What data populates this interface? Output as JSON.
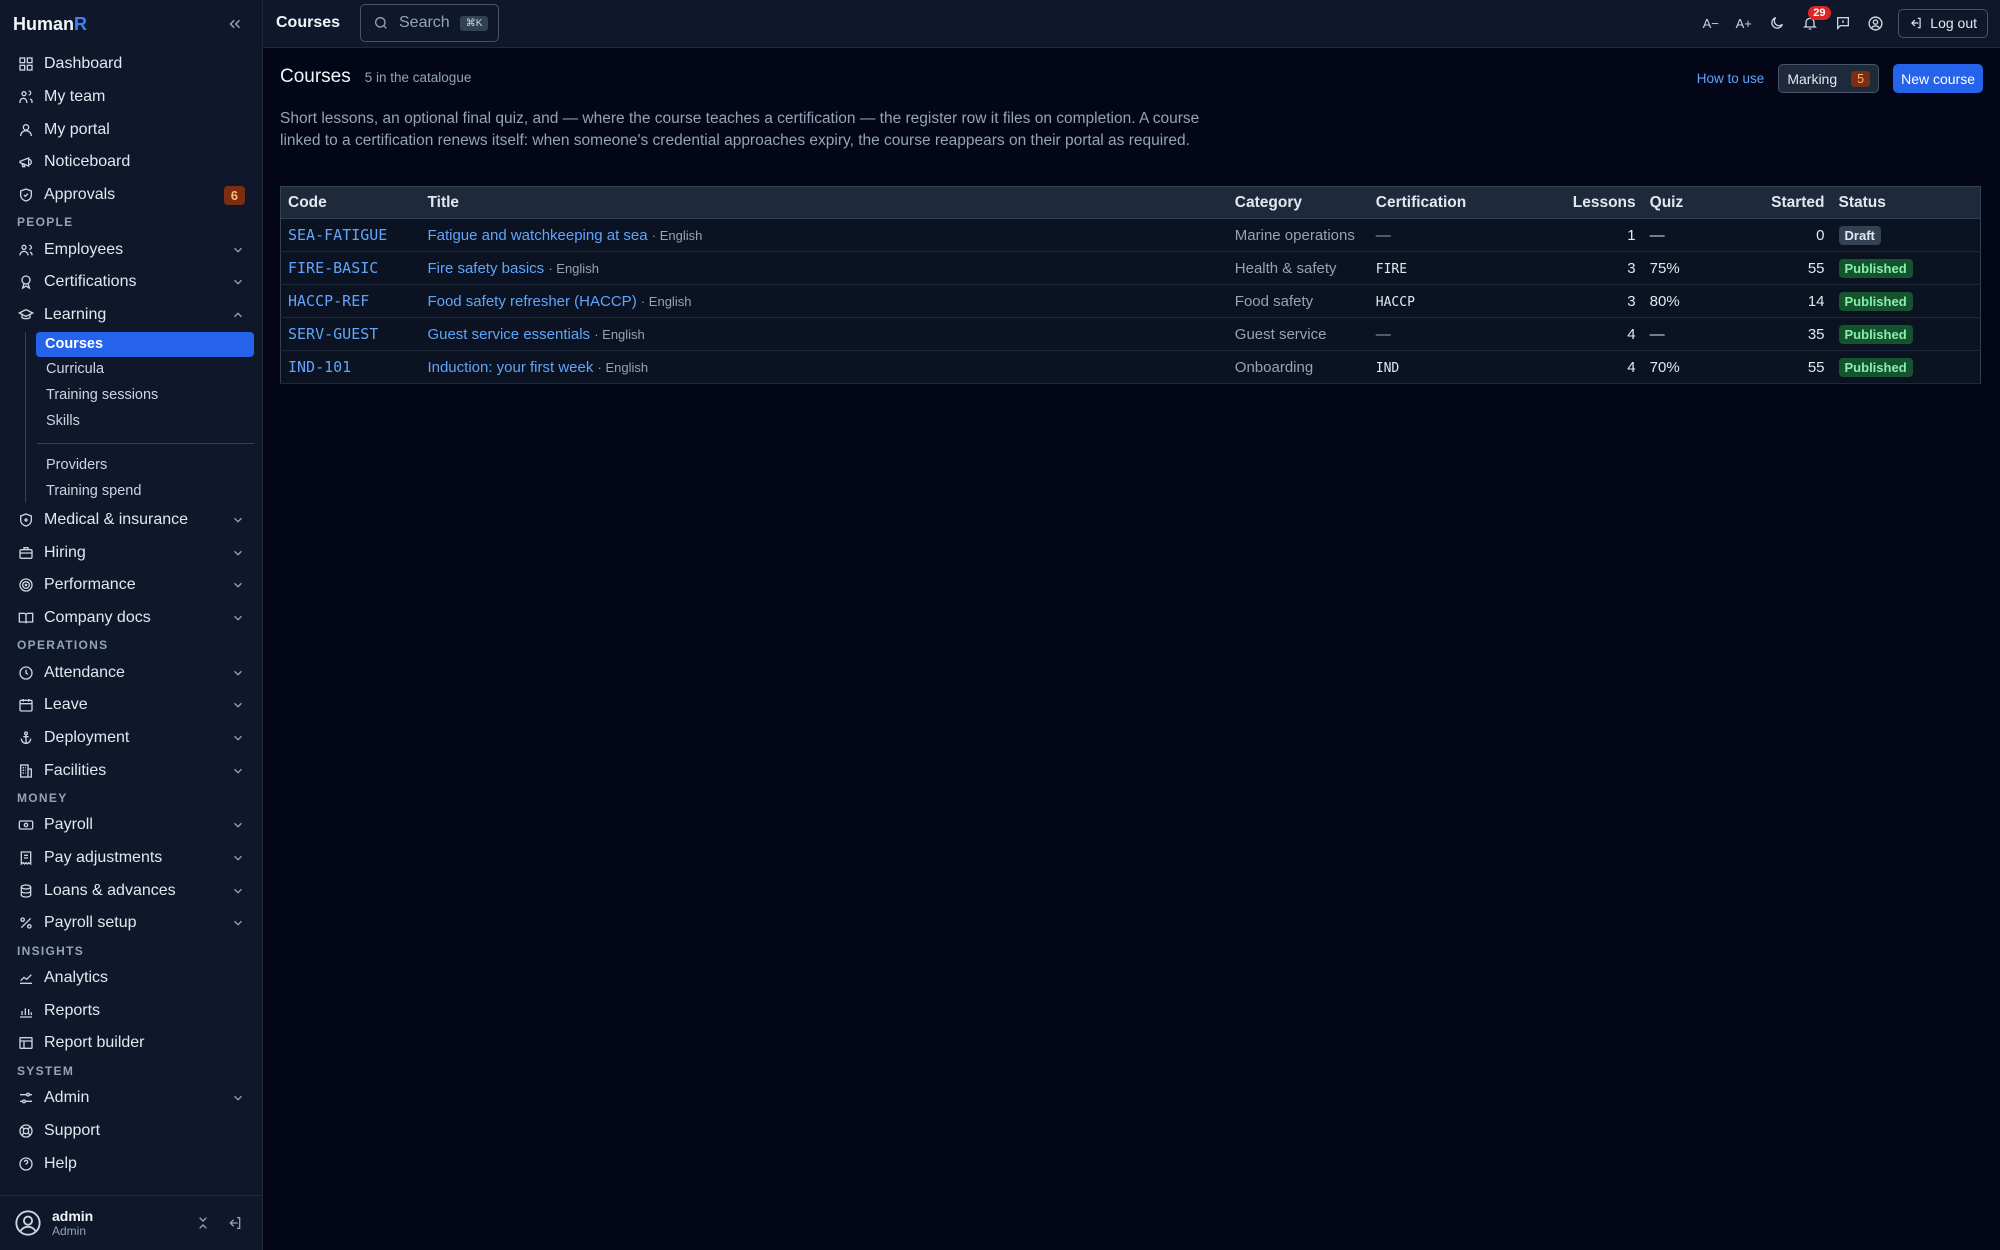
{
  "brand": {
    "name": "Human",
    "accent": "R"
  },
  "sidebar": {
    "top": [
      {
        "label": "Dashboard",
        "icon": "dashboard-icon"
      },
      {
        "label": "My team",
        "icon": "team-icon"
      },
      {
        "label": "My portal",
        "icon": "user-icon"
      },
      {
        "label": "Noticeboard",
        "icon": "megaphone-icon"
      },
      {
        "label": "Approvals",
        "icon": "shield-check-icon",
        "badge": "6"
      }
    ],
    "sections": {
      "people": "PEOPLE",
      "operations": "OPERATIONS",
      "money": "MONEY",
      "insights": "INSIGHTS",
      "system": "SYSTEM"
    },
    "people": [
      {
        "label": "Employees"
      },
      {
        "label": "Certifications"
      },
      {
        "label": "Learning"
      }
    ],
    "learning_sub": [
      "Courses",
      "Curricula",
      "Training sessions",
      "Skills"
    ],
    "learning_sub2": [
      "Providers",
      "Training spend"
    ],
    "people_rest": [
      "Medical & insurance",
      "Hiring",
      "Performance",
      "Company docs"
    ],
    "operations": [
      "Attendance",
      "Leave",
      "Deployment",
      "Facilities"
    ],
    "money": [
      "Payroll",
      "Pay adjustments",
      "Loans & advances",
      "Payroll setup"
    ],
    "insights": [
      "Analytics",
      "Reports",
      "Report builder"
    ],
    "system": [
      "Admin",
      "Support",
      "Help"
    ]
  },
  "user": {
    "name": "admin",
    "role": "Admin"
  },
  "topbar": {
    "title": "Courses",
    "search_label": "Search",
    "search_kbd": "⌘K",
    "font_smaller": "A−",
    "font_larger": "A+",
    "notif_count": "29",
    "logout": "Log out"
  },
  "page": {
    "title": "Courses",
    "count": "5 in the catalogue",
    "how_to": "How to use",
    "marking": "Marking",
    "marking_count": "5",
    "new_course": "New course",
    "description": "Short lessons, an optional final quiz, and — where the course teaches a certification — the register row it files on completion. A course linked to a certification renews itself: when someone's credential approaches expiry, the course reappears on their portal as required."
  },
  "table": {
    "headers": {
      "code": "Code",
      "title": "Title",
      "category": "Category",
      "certification": "Certification",
      "lessons": "Lessons",
      "quiz": "Quiz",
      "started": "Started",
      "status": "Status"
    },
    "rows": [
      {
        "code": "SEA-FATIGUE",
        "title": "Fatigue and watchkeeping at sea",
        "lang": "· English",
        "category": "Marine operations",
        "cert": "—",
        "lessons": "1",
        "quiz": "—",
        "started": "0",
        "status": "Draft"
      },
      {
        "code": "FIRE-BASIC",
        "title": "Fire safety basics",
        "lang": "· English",
        "category": "Health & safety",
        "cert": "FIRE",
        "lessons": "3",
        "quiz": "75%",
        "started": "55",
        "status": "Published"
      },
      {
        "code": "HACCP-REF",
        "title": "Food safety refresher (HACCP)",
        "lang": "· English",
        "category": "Food safety",
        "cert": "HACCP",
        "lessons": "3",
        "quiz": "80%",
        "started": "14",
        "status": "Published"
      },
      {
        "code": "SERV-GUEST",
        "title": "Guest service essentials",
        "lang": "· English",
        "category": "Guest service",
        "cert": "—",
        "lessons": "4",
        "quiz": "—",
        "started": "35",
        "status": "Published"
      },
      {
        "code": "IND-101",
        "title": "Induction: your first week",
        "lang": "· English",
        "category": "Onboarding",
        "cert": "IND",
        "lessons": "4",
        "quiz": "70%",
        "started": "55",
        "status": "Published"
      }
    ]
  },
  "colors": {
    "accent": "#2563eb",
    "background": "#020617",
    "sidebar": "#0f172a",
    "published": "#14532d",
    "notification": "#dc2626"
  }
}
